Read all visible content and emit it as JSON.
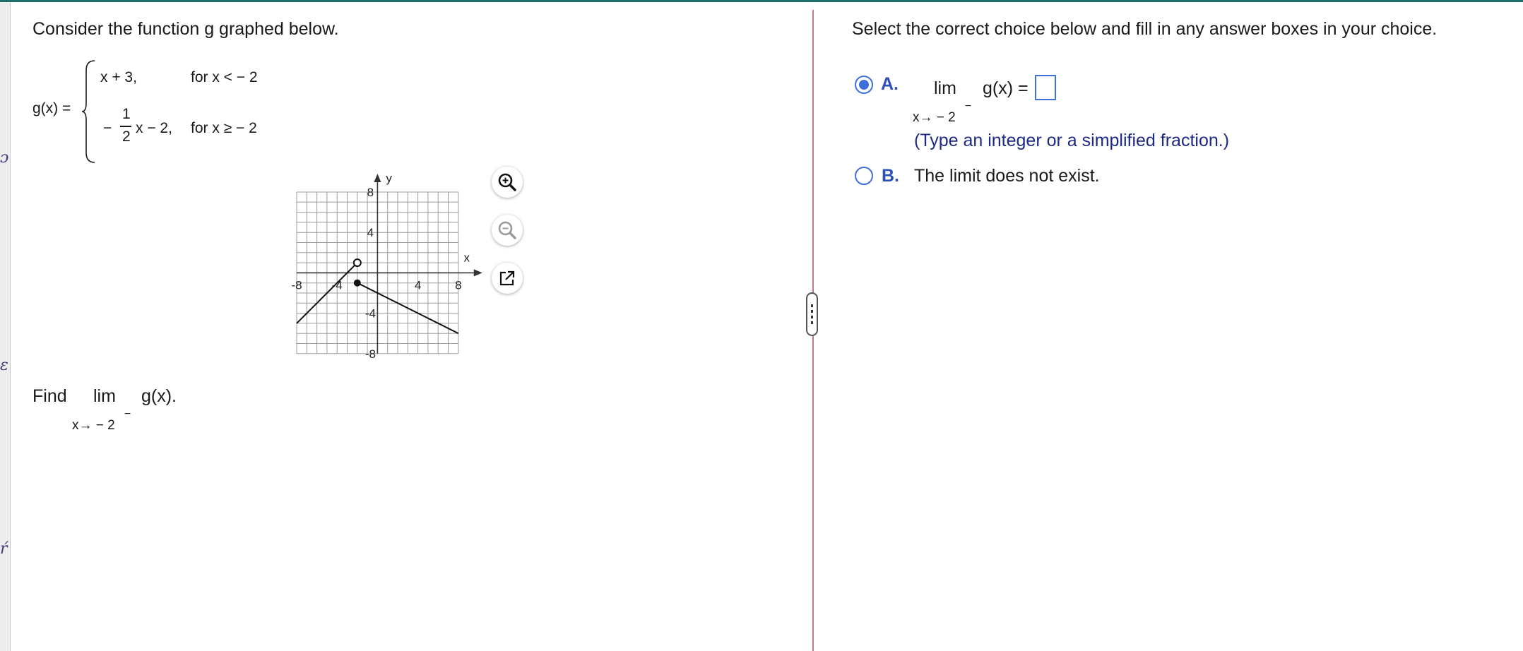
{
  "left_panel": {
    "intro": "Consider the function g graphed below.",
    "func_name": "g(x) =",
    "piece1_expr": "x + 3,",
    "piece1_cond": "for x < − 2",
    "piece2_neg": "−",
    "piece2_num": "1",
    "piece2_den": "2",
    "piece2_rest": "x − 2,",
    "piece2_cond": "for x ≥ − 2",
    "find_label": "Find",
    "lim_label": "lim",
    "lim_sub": "x→ − 2",
    "lim_sup": "−",
    "lim_expr": "g(x)."
  },
  "graph": {
    "x_axis_label": "x",
    "y_axis_label": "y",
    "x_range": [
      -8,
      8
    ],
    "y_range": [
      -8,
      8
    ],
    "ticks": {
      "x_neg8": "-8",
      "x_neg4": "-4",
      "x_pos4": "4",
      "x_pos8": "8",
      "y_pos8": "8",
      "y_pos4": "4",
      "y_neg4": "-4",
      "y_neg8": "-8"
    },
    "piece1": {
      "from": [
        -8,
        -5
      ],
      "to": [
        -2,
        1
      ],
      "endpoint": "open"
    },
    "piece2": {
      "from": [
        -2,
        -1
      ],
      "to": [
        8,
        -6
      ],
      "endpoint": "closed"
    }
  },
  "tools": {
    "zoom_in_icon": "zoom-in-icon",
    "zoom_out_icon": "zoom-out-icon",
    "popout_icon": "external-link-icon"
  },
  "right_panel": {
    "instruction": "Select the correct choice below and fill in any answer boxes in your choice.",
    "choice_a_letter": "A.",
    "choice_a_lim": "lim",
    "choice_a_sub": "x→ − 2",
    "choice_a_sup": "−",
    "choice_a_expr": "g(x) =",
    "choice_a_answer": "",
    "choice_a_hint": "(Type an integer or a simplified fraction.)",
    "choice_b_letter": "B.",
    "choice_b_text": "The limit does not exist.",
    "selected_choice": "A"
  },
  "colors": {
    "accent": "#3f6fd9",
    "choice_letter": "#2b4fb3",
    "hint": "#1c2a85",
    "divider": "#c07f86",
    "top_bar": "#1f6e6a"
  }
}
